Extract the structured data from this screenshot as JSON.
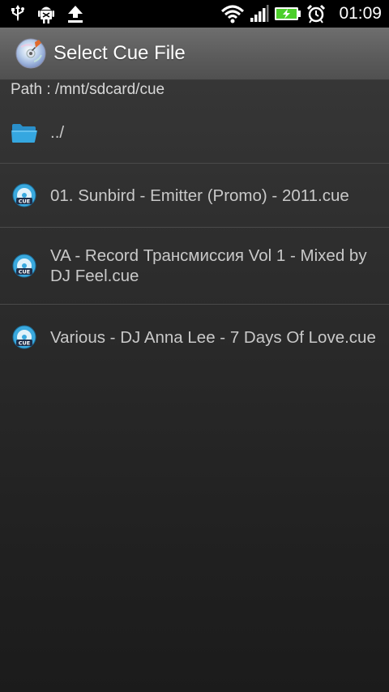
{
  "status_bar": {
    "left_icons": [
      "usb-icon",
      "android-debug-icon",
      "upload-icon"
    ],
    "right_icons": [
      "wifi-icon",
      "signal-icon",
      "battery-charging-icon",
      "alarm-icon"
    ],
    "time": "01:09",
    "battery_color": "#4ccf2a"
  },
  "title_bar": {
    "title": "Select Cue File",
    "icon": "cd-app-icon"
  },
  "path": {
    "text": "Path : /mnt/sdcard/cue"
  },
  "files": [
    {
      "icon": "folder-icon",
      "label": "../"
    },
    {
      "icon": "cue-file-icon",
      "label": "01. Sunbird - Emitter (Promo) - 2011.cue"
    },
    {
      "icon": "cue-file-icon",
      "label": "VA - Record Трансмиссия Vol 1 - Mixed by DJ Feel.cue"
    },
    {
      "icon": "cue-file-icon",
      "label": "Various - DJ Anna Lee - 7 Days Of Love.cue"
    }
  ],
  "colors": {
    "status_bar_bg": "#000000",
    "title_bar_bg": "#5e5e5e",
    "list_bg": "#2b2b2b",
    "folder_blue": "#35a7e0",
    "cue_blue": "#3aa9de"
  }
}
